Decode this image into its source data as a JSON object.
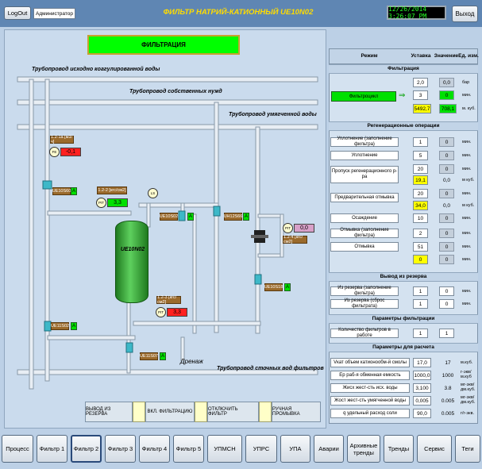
{
  "header": {
    "logout_label": "LogOut",
    "user_name": "Администратор",
    "title": "ФИЛЬТР НАТРИЙ-КАТИОННЫЙ UE10N02",
    "datetime": "12/26/2014 3:26:07 PM",
    "exit_label": "Выход"
  },
  "mode_banner": "ФИЛЬТРАЦИЯ",
  "pipes": {
    "source": "Трубопровод исходно коагулированной воды",
    "own_needs": "Трубопровод собственных нужд",
    "softened": "Трубопровод умягченной воды",
    "drain": "Дренаж",
    "wastewater": "Трубопровод сточных вод фильтров"
  },
  "scheme": {
    "tank_label": "UE10N02",
    "instr1_tag": "1.2-1а [м3/ч]",
    "instr1_sym": "FE",
    "instr1_value": "-0,1",
    "instr2_tag": "1.2-2 [кгс/см2]",
    "instr2_sym": "PIT",
    "instr2_value": "3,3",
    "instr3_tag": "1.2-3 [кгс/см2]",
    "instr3_sym": "PIT",
    "instr3_value": "3,3",
    "instr4_sym": "PIT",
    "instr4_value": "0,0",
    "instr4_tag": "1.2-4 [кгс/см2]",
    "ls_label": "LS",
    "valve_ue10s60": "UE10S60",
    "valve_ue10s02": "UE10S02",
    "valve_uh12s66": "UH12S66",
    "valve_ue10s18": "UE10S18",
    "valve_ue11s02": "UE11S02",
    "valve_ue11s07": "UE11S07",
    "valve_state": "A"
  },
  "actions": [
    {
      "label": "ВЫВОД ИЗ РЕЗЕРВА"
    },
    {
      "label": "ВКЛ. ФИЛЬТРАЦИЮ"
    },
    {
      "label": "ОТКЛЮЧИТЬ ФИЛЬТР"
    },
    {
      "label": "РУЧНАЯ ПРОМЫВКА"
    }
  ],
  "panel": {
    "col_mode": "Режим",
    "col_setpoint": "Уставка",
    "col_value": "Значение",
    "col_unit": "Ед. изм.",
    "sec_filtration": "Фильтрация",
    "filter_cycle_label": "Фильтроцикл",
    "filtration_rows": [
      {
        "setpoint": "2,0",
        "value": "0,0",
        "unit": "бар"
      },
      {
        "setpoint": "3",
        "value": "0",
        "unit": "мин."
      },
      {
        "setpoint": "5492,7",
        "value": "708,1",
        "unit": "м. куб."
      }
    ],
    "sec_regen": "Регенерационные операции",
    "regen_rows": [
      {
        "label": "Уплотнение (заполнение фильтра)",
        "setpoint": "1",
        "value": "0",
        "unit": "мин."
      },
      {
        "label": "Уплотнение",
        "setpoint": "5",
        "value": "0",
        "unit": "мин."
      },
      {
        "label": "Пропуск регенерационного р-ра",
        "setpoint": "20",
        "value": "0",
        "unit": "мин.",
        "setpoint2": "19,1",
        "value2": "0,0",
        "unit2": "м куб."
      },
      {
        "label": "Предварительная отмывка",
        "setpoint": "20",
        "value": "0",
        "unit": "мин.",
        "setpoint2": "34,0",
        "value2": "0,0",
        "unit2": "м куб."
      },
      {
        "label": "Осаждение",
        "setpoint": "10",
        "value": "0",
        "unit": "мин."
      },
      {
        "label": "Отмывка (заполнение фильтра)",
        "setpoint": "2",
        "value": "0",
        "unit": "мин."
      },
      {
        "label": "Отмывка",
        "setpoint": "51",
        "value": "0",
        "unit": "мин.",
        "setpoint2": "0",
        "value2": "0",
        "unit2": "мин."
      }
    ],
    "sec_reserve": "Вывод из резерва",
    "reserve_rows": [
      {
        "label": "Из резерва (заполнение фильтра)",
        "setpoint": "1",
        "value": "0",
        "unit": "мин."
      },
      {
        "label": "Из резерва (сброс фильтрата)",
        "setpoint": "1",
        "value": "0",
        "unit": "мин."
      }
    ],
    "sec_params": "Параметры фильтрации",
    "params_row": {
      "label": "Количество фильтров в работе",
      "setpoint": "1",
      "value": "1"
    },
    "sec_calc": "Параметры для расчета",
    "calc_rows": [
      {
        "label": "Vкат объем катионообм-й смолы",
        "setpoint": "17,0",
        "value": "17",
        "unit": "м.куб."
      },
      {
        "label": "Ер раб-я обменная емкость",
        "setpoint": "1000,0",
        "value": "1000",
        "unit": "г-экв/ м.куб"
      },
      {
        "label": "Жисх жест-сть исх. воды",
        "setpoint": "3,100",
        "value": "3.8",
        "unit": "мг-экв/ дм.куб."
      },
      {
        "label": "Жост жест-сть умягченной воды",
        "setpoint": "0,005",
        "value": "0.005",
        "unit": "мг-экв/ дм.куб."
      },
      {
        "label": "q удельный расход соли",
        "setpoint": "90,0",
        "value": "0.005",
        "unit": "г/г-экв."
      }
    ]
  },
  "nav": [
    {
      "label": "Процесс"
    },
    {
      "label": "Фильтр 1"
    },
    {
      "label": "Фильтр 2"
    },
    {
      "label": "Фильтр 3"
    },
    {
      "label": "Фильтр 4"
    },
    {
      "label": "Фильтр 5"
    },
    {
      "label": "УПМСН"
    },
    {
      "label": "УПРС"
    },
    {
      "label": "УПА"
    },
    {
      "label": "Аварии"
    },
    {
      "label": "Архивные тренды"
    },
    {
      "label": "Тренды"
    },
    {
      "label": "Сервис"
    },
    {
      "label": "Теги"
    }
  ],
  "colors": {
    "alarm": "#ff2020",
    "ok": "#00e000",
    "tank": "#3aa83a",
    "banner": "#00ff00",
    "title": "#ffdc00"
  }
}
